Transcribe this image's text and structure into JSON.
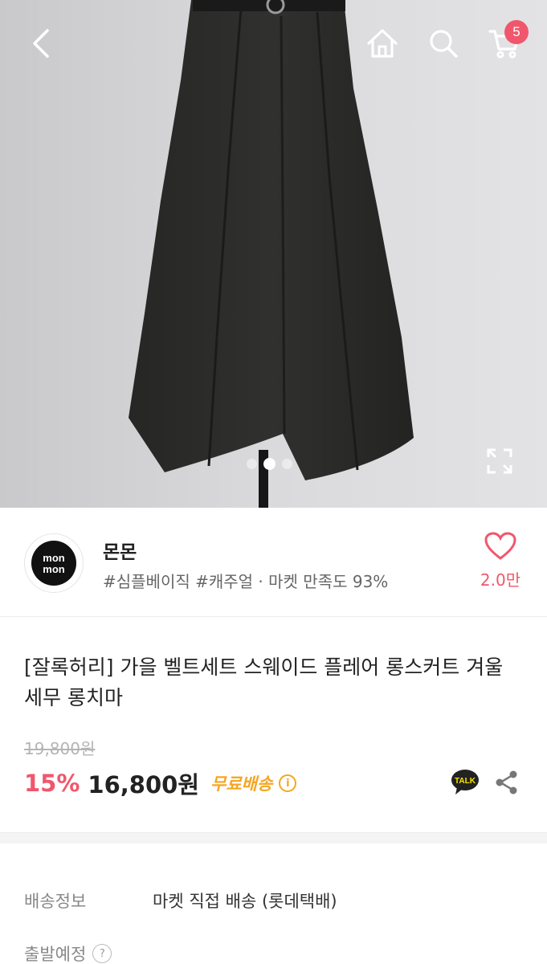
{
  "header": {
    "cart_count": "5",
    "icons": [
      "back-arrow-icon",
      "home-icon",
      "search-icon",
      "cart-icon"
    ]
  },
  "gallery": {
    "image_count": 3,
    "active_index": 1
  },
  "shop": {
    "name": "몬몬",
    "logo_text": "mon mon",
    "tags": "#심플베이직 #캐주얼 · 마켓 만족도 93%",
    "like_count": "2.0만"
  },
  "product": {
    "title": "[잘록허리] 가을 벨트세트 스웨이드 플레어 롱스커트 겨울 세무 롱치마",
    "original_price": "19,800원",
    "discount": "15%",
    "price": "16,800원",
    "shipping_badge": "무료배송",
    "info_icon": "i",
    "talk_label": "TALK"
  },
  "delivery": {
    "rows": [
      {
        "label": "배송정보",
        "value": "마켓 직접 배송 (롯데택배)"
      },
      {
        "label": "출발예정",
        "value": ""
      }
    ],
    "help_icon": "?"
  },
  "colors": {
    "accent": "#f0576c",
    "shipping": "#f5a623"
  }
}
